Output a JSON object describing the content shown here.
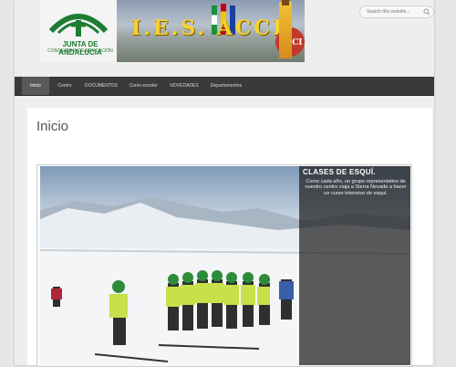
{
  "header": {
    "logo": {
      "line1": "JUNTA DE ANDALUCIA",
      "line2": "CONSEJERÍA DE EDUCACIÓN"
    },
    "school_title": "I.E.S. ACCI",
    "school_logo_text": "ACCI",
    "search": {
      "placeholder": "Search this website..."
    }
  },
  "nav": {
    "items": [
      {
        "label": "Inicio",
        "active": true
      },
      {
        "label": "Centro"
      },
      {
        "label": "DOCUMENTOS"
      },
      {
        "label": "Curso escolar"
      },
      {
        "label": "NOVEDADES"
      },
      {
        "label": "Departamentos"
      }
    ]
  },
  "main": {
    "page_title": "Inicio",
    "slide": {
      "title": "CLASES DE ESQUÍ.",
      "text": "Como cada año, un grupo representativo de nuestro centro viaja a Sierra Nevada a hacer un curso intensivo de esquí."
    }
  },
  "colors": {
    "nav_bg": "#3a3a3a",
    "nav_active": "#595959",
    "brand_green": "#1c7d33",
    "title_gold": "#f6d12f"
  }
}
